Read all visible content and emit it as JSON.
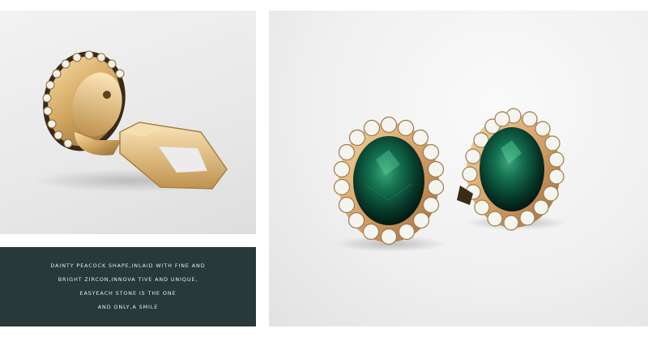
{
  "caption": {
    "lines": [
      "DAINTY PEACOCK SHAPE,INLAID WITH FINE AND",
      "BRIGHT ZIRCON,INNOVA TIVE AND UNIQUE,",
      "EASYEACH STONE IS THE ONE",
      "AND ONLY,A SMILE"
    ]
  },
  "colors": {
    "caption_bg": "#27393a",
    "caption_text": "#e8ece9",
    "gold": "#d9ad6a",
    "emerald": "#0f4a33"
  }
}
